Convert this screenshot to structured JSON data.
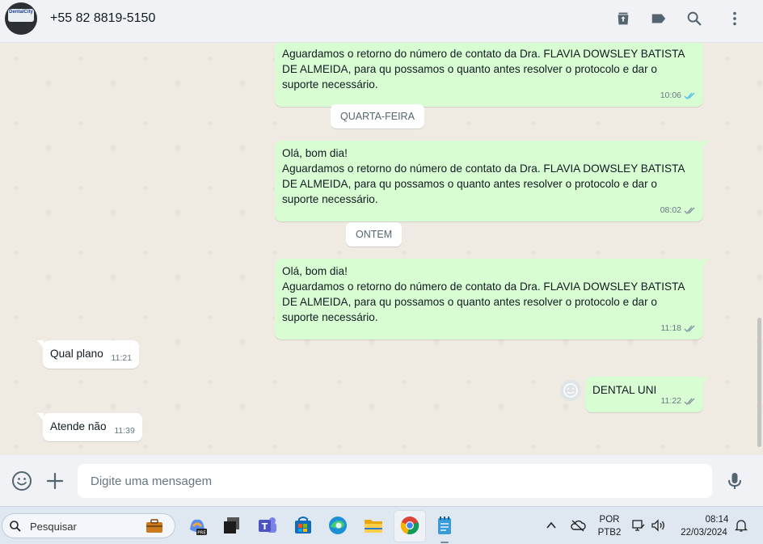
{
  "header": {
    "avatar_text": "DentalCity",
    "contact_name": "+55 82 8819-5150",
    "icons": [
      "archive-icon",
      "label-icon",
      "search-icon",
      "menu-icon"
    ]
  },
  "messages": [
    {
      "text": "Aguardamos o retorno do número de contato da Dra. FLAVIA DOWSLEY BATISTA DE ALMEIDA, para qu possamos o quanto antes resolver o protocolo e dar o suporte necessário.",
      "time": "10:06",
      "status": "read"
    },
    {
      "date_chip": "QUARTA-FEIRA"
    },
    {
      "greeting": "Olá, bom dia!",
      "text": "Aguardamos o retorno do número de contato da Dra. FLAVIA DOWSLEY BATISTA DE ALMEIDA, para qu possamos o quanto antes resolver o protocolo e dar o suporte necessário.",
      "time": "08:02",
      "status": "delivered"
    },
    {
      "date_chip": "ONTEM"
    },
    {
      "greeting": "Olá, bom dia!",
      "text": "Aguardamos o retorno do número de contato da Dra. FLAVIA DOWSLEY BATISTA DE ALMEIDA, para qu possamos o quanto antes resolver o protocolo e dar o suporte necessário.",
      "time": "11:18",
      "status": "delivered"
    },
    {
      "text": "Qual plano",
      "time": "11:21",
      "direction": "incoming"
    },
    {
      "text": "DENTAL UNI",
      "time": "11:22",
      "direction": "outgoing",
      "status": "delivered"
    },
    {
      "text": "Atende não",
      "time": "11:39",
      "direction": "incoming"
    }
  ],
  "composer": {
    "placeholder": "Digite uma mensagem",
    "icons": [
      "emoji-icon",
      "plus-icon",
      "microphone-icon"
    ]
  },
  "taskbar": {
    "search_label": "Pesquisar",
    "lang_top": "POR",
    "lang_bottom": "PTB2",
    "time": "08:14",
    "date": "22/03/2024"
  },
  "colors": {
    "outgoing_bubble": "#d9fdd3",
    "incoming_bubble": "#ffffff",
    "chat_bg": "#efeae2",
    "read_tick": "#53bdeb",
    "header_bg": "#f0f2f5"
  }
}
